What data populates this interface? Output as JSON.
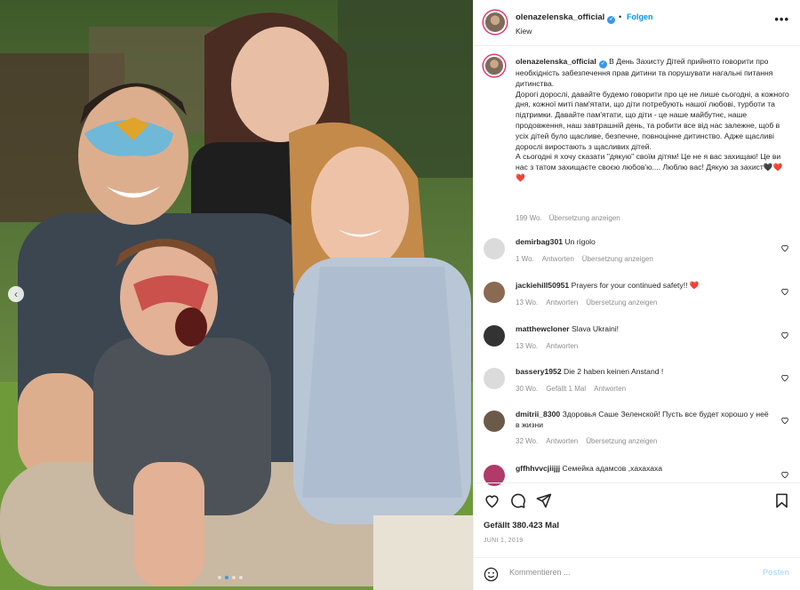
{
  "post": {
    "username": "olenazelenska_official",
    "follow_label": "Folgen",
    "location": "Kiew",
    "separator": "•",
    "more_label": "•••"
  },
  "caption": {
    "username": "olenazelenska_official",
    "text": "В День Захисту Дітей прийнято говорити про необхідність забезпечення прав дитини та порушувати нагальні питання дитинства.\nДорогі дорослі, давайте будемо говорити про це не лише сьогодні, а кожного дня, кожної миті пам'ятати, що діти потребують нашої любові, турботи та підтримки. Давайте пам'ятати, що діти - це наше майбутнє, наше продовження, наш завтрашній день, та робити все від нас залежне, щоб в усіх дітей було щасливе, безпечне, повноцінне дитинство. Адже щасливі дорослі виростають з щасливих дітей.\nА сьогодні я хочу сказати \"дякую\" своїм дітям! Це не я вас захищаю! Це ви нас з татом захищаєте своєю любов'ю.... Люблю вас! Дякую за захист🖤❤️❤️",
    "likes": "199 Wo.",
    "translate": "Übersetzung anzeigen"
  },
  "comments": [
    {
      "username": "demirbag301",
      "text": "Un rigolo",
      "time": "1 Wo.",
      "reply": "Antworten",
      "likes": "",
      "translate": "Übersetzung anzeigen",
      "avatar_color": "#dbdbdb"
    },
    {
      "username": "jackiehill50951",
      "text": "Prayers for your continued safety!! ❤️",
      "time": "13 Wo.",
      "reply": "Antworten",
      "likes": "",
      "translate": "Übersetzung anzeigen",
      "avatar_color": "#8a6a52"
    },
    {
      "username": "matthewcloner",
      "text": "Slava Ukraini!",
      "time": "13 Wo.",
      "reply": "Antworten",
      "likes": "",
      "translate": "",
      "avatar_color": "#333333"
    },
    {
      "username": "bassery1952",
      "text": "Die 2 haben keinen Anstand !",
      "time": "30 Wo.",
      "reply": "Antworten",
      "likes": "Gefällt 1 Mal",
      "translate": "",
      "avatar_color": "#dbdbdb"
    },
    {
      "username": "dmitrii_8300",
      "text": "Здоровья Саше Зеленской! Пусть все будет хорошо у неё в жизни",
      "time": "32 Wo.",
      "reply": "Antworten",
      "likes": "",
      "translate": "Übersetzung anzeigen",
      "avatar_color": "#6b5a4a"
    },
    {
      "username": "gffhhvvcjiijjj",
      "text": "Семейка адамсов ,хахахаха",
      "time": "",
      "reply": "",
      "likes": "",
      "translate": "",
      "avatar_color": "#b03a6a"
    }
  ],
  "actions": {
    "likes_text": "Gefällt 380.423 Mal",
    "date": "JUNI 1, 2019",
    "comment_placeholder": "Kommentieren ...",
    "post_label": "Posten"
  },
  "icons": {
    "like": "heart-icon",
    "comment": "comment-icon",
    "share": "share-icon",
    "save": "bookmark-icon",
    "emoji": "emoji-icon",
    "prev": "chevron-left-icon"
  },
  "colors": {
    "accent": "#0095f6",
    "verified": "#3897f0",
    "muted": "#8e8e8e",
    "heart_red": "#ed4956"
  },
  "carousel": {
    "total": 4,
    "active_index": 1
  }
}
